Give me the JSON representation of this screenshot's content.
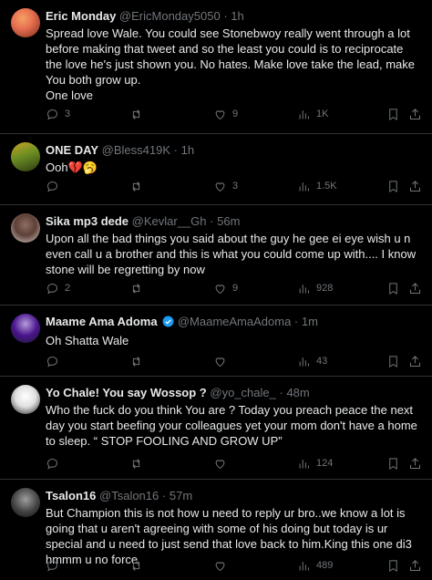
{
  "tweets": [
    {
      "name": "Eric Monday",
      "handle": "@EricMonday5050",
      "sep": "·",
      "time": "1h",
      "text": "Spread love Wale. You could see Stonebwoy really went through a lot before making that tweet and so the least you could is to reciprocate the love he's just shown you. No hates. Make love take the lead, make You both grow up.\nOne love",
      "replies": "3",
      "retweets": "",
      "likes": "9",
      "views": "1K"
    },
    {
      "name": "ONE DAY",
      "handle": "@Bless419K",
      "sep": "·",
      "time": "1h",
      "text": "Ooh💔🥱",
      "replies": "",
      "retweets": "",
      "likes": "3",
      "views": "1.5K"
    },
    {
      "name": "Sika mp3 dede",
      "handle": "@Kevlar__Gh",
      "sep": "·",
      "time": "56m",
      "text": "Upon all the bad things you said about the guy he gee ei eye wish u n even call u a brother and this is what you could come up with.... I know stone will be regretting by now",
      "replies": "2",
      "retweets": "",
      "likes": "9",
      "views": "928"
    },
    {
      "name": "Maame Ama Adoma",
      "handle": "@MaameAmaAdoma",
      "sep": "·",
      "time": "1m",
      "text": "Oh Shatta Wale",
      "replies": "",
      "retweets": "",
      "likes": "",
      "views": "43"
    },
    {
      "name": "Yo Chale! You say Wossop ?",
      "handle": "@yo_chale_",
      "sep": "·",
      "time": "48m",
      "text": "Who the fuck do you think You are ? Today you preach peace the next day you start beefing your colleagues yet your mom don't have a home to sleep. “ STOP FOOLING AND GROW UP”",
      "replies": "",
      "retweets": "",
      "likes": "",
      "views": "124"
    },
    {
      "name": "Tsalon16",
      "handle": "@Tsalon16",
      "sep": "·",
      "time": "57m",
      "text": "But Champion this is not how u need to reply ur bro..we know a lot is going that u aren't agreeing with some of his doing but today is ur special and u need to just send that love back to him.King this one di3 hmmm u no force",
      "replies": "",
      "retweets": "",
      "likes": "",
      "views": "489"
    }
  ],
  "colors": {
    "background": "#000000",
    "text": "#e7e9ea",
    "muted": "#71767b",
    "divider": "#2f3336",
    "verified": "#1d9bf0"
  },
  "icons": [
    "reply-icon",
    "retweet-icon",
    "like-icon",
    "views-icon",
    "bookmark-icon",
    "share-icon",
    "verified-badge-icon"
  ]
}
